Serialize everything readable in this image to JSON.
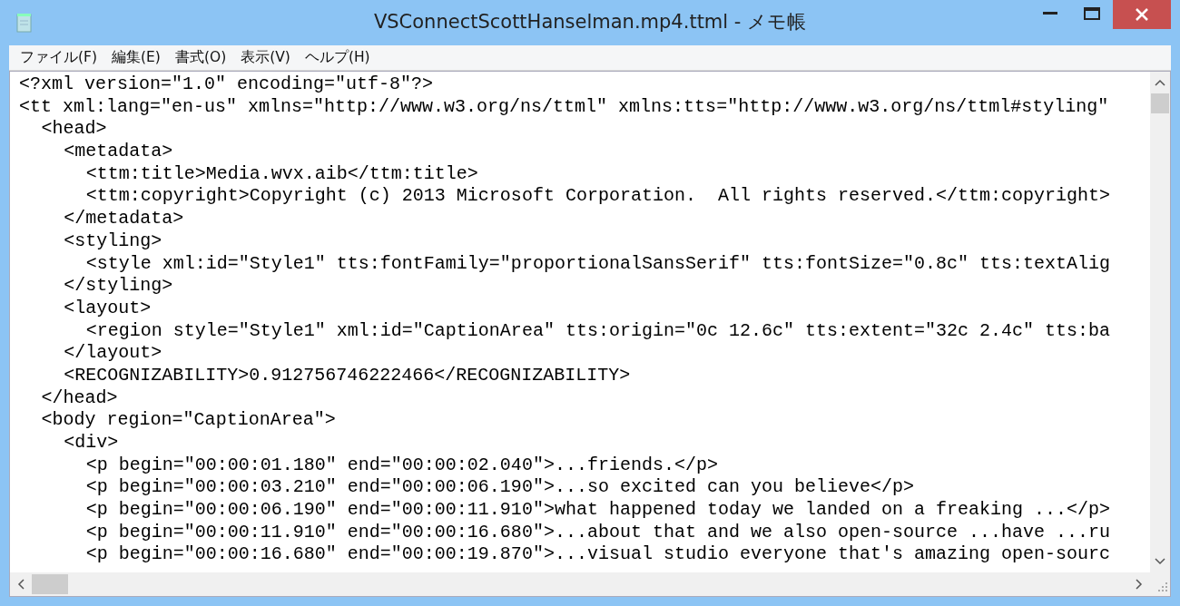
{
  "window": {
    "title": "VSConnectScottHanselman.mp4.ttml - メモ帳"
  },
  "menu": [
    "ファイル(F)",
    "編集(E)",
    "書式(O)",
    "表示(V)",
    "ヘルプ(H)"
  ],
  "lines": [
    {
      "text": "<?xml version=\"1.0\" encoding=\"utf-8\"?>"
    },
    {
      "text": "<tt xml:lang=\"en-us\" xmlns=\"http://www.w3.org/ns/ttml\" xmlns:tts=\"http://www.w3.org/ns/ttml#styling\"",
      "children": [
        {
          "text": "<head>",
          "children": [
            {
              "text": "<metadata>",
              "children": [
                {
                  "text": "<ttm:title>Media.wvx.aib</ttm:title>"
                },
                {
                  "text": "<ttm:copyright>Copyright (c) 2013 Microsoft Corporation.  All rights reserved.</ttm:copyright>"
                }
              ]
            },
            {
              "text": "</metadata>"
            },
            {
              "text": "<styling>",
              "children": [
                {
                  "text": "<style xml:id=\"Style1\" tts:fontFamily=\"proportionalSansSerif\" tts:fontSize=\"0.8c\" tts:textAlig"
                }
              ]
            },
            {
              "text": "</styling>"
            },
            {
              "text": "<layout>",
              "children": [
                {
                  "text": "<region style=\"Style1\" xml:id=\"CaptionArea\" tts:origin=\"0c 12.6c\" tts:extent=\"32c 2.4c\" tts:ba"
                }
              ]
            },
            {
              "text": "</layout>"
            },
            {
              "text": "<RECOGNIZABILITY>0.912756746222466</RECOGNIZABILITY>"
            }
          ]
        },
        {
          "text": "</head>"
        },
        {
          "text": "<body region=\"CaptionArea\">",
          "children": [
            {
              "text": "<div>",
              "children": [
                {
                  "text": "<p begin=\"00:00:01.180\" end=\"00:00:02.040\">...friends.</p>"
                },
                {
                  "text": "<p begin=\"00:00:03.210\" end=\"00:00:06.190\">...so excited can you believe</p>"
                },
                {
                  "text": "<p begin=\"00:00:06.190\" end=\"00:00:11.910\">what happened today we landed on a freaking ...</p>"
                },
                {
                  "text": "<p begin=\"00:00:11.910\" end=\"00:00:16.680\">...about that and we also open-source ...have ...ru"
                },
                {
                  "text": "<p begin=\"00:00:16.680\" end=\"00:00:19.870\">...visual studio everyone that's amazing open-sourc"
                }
              ]
            }
          ]
        }
      ]
    }
  ]
}
